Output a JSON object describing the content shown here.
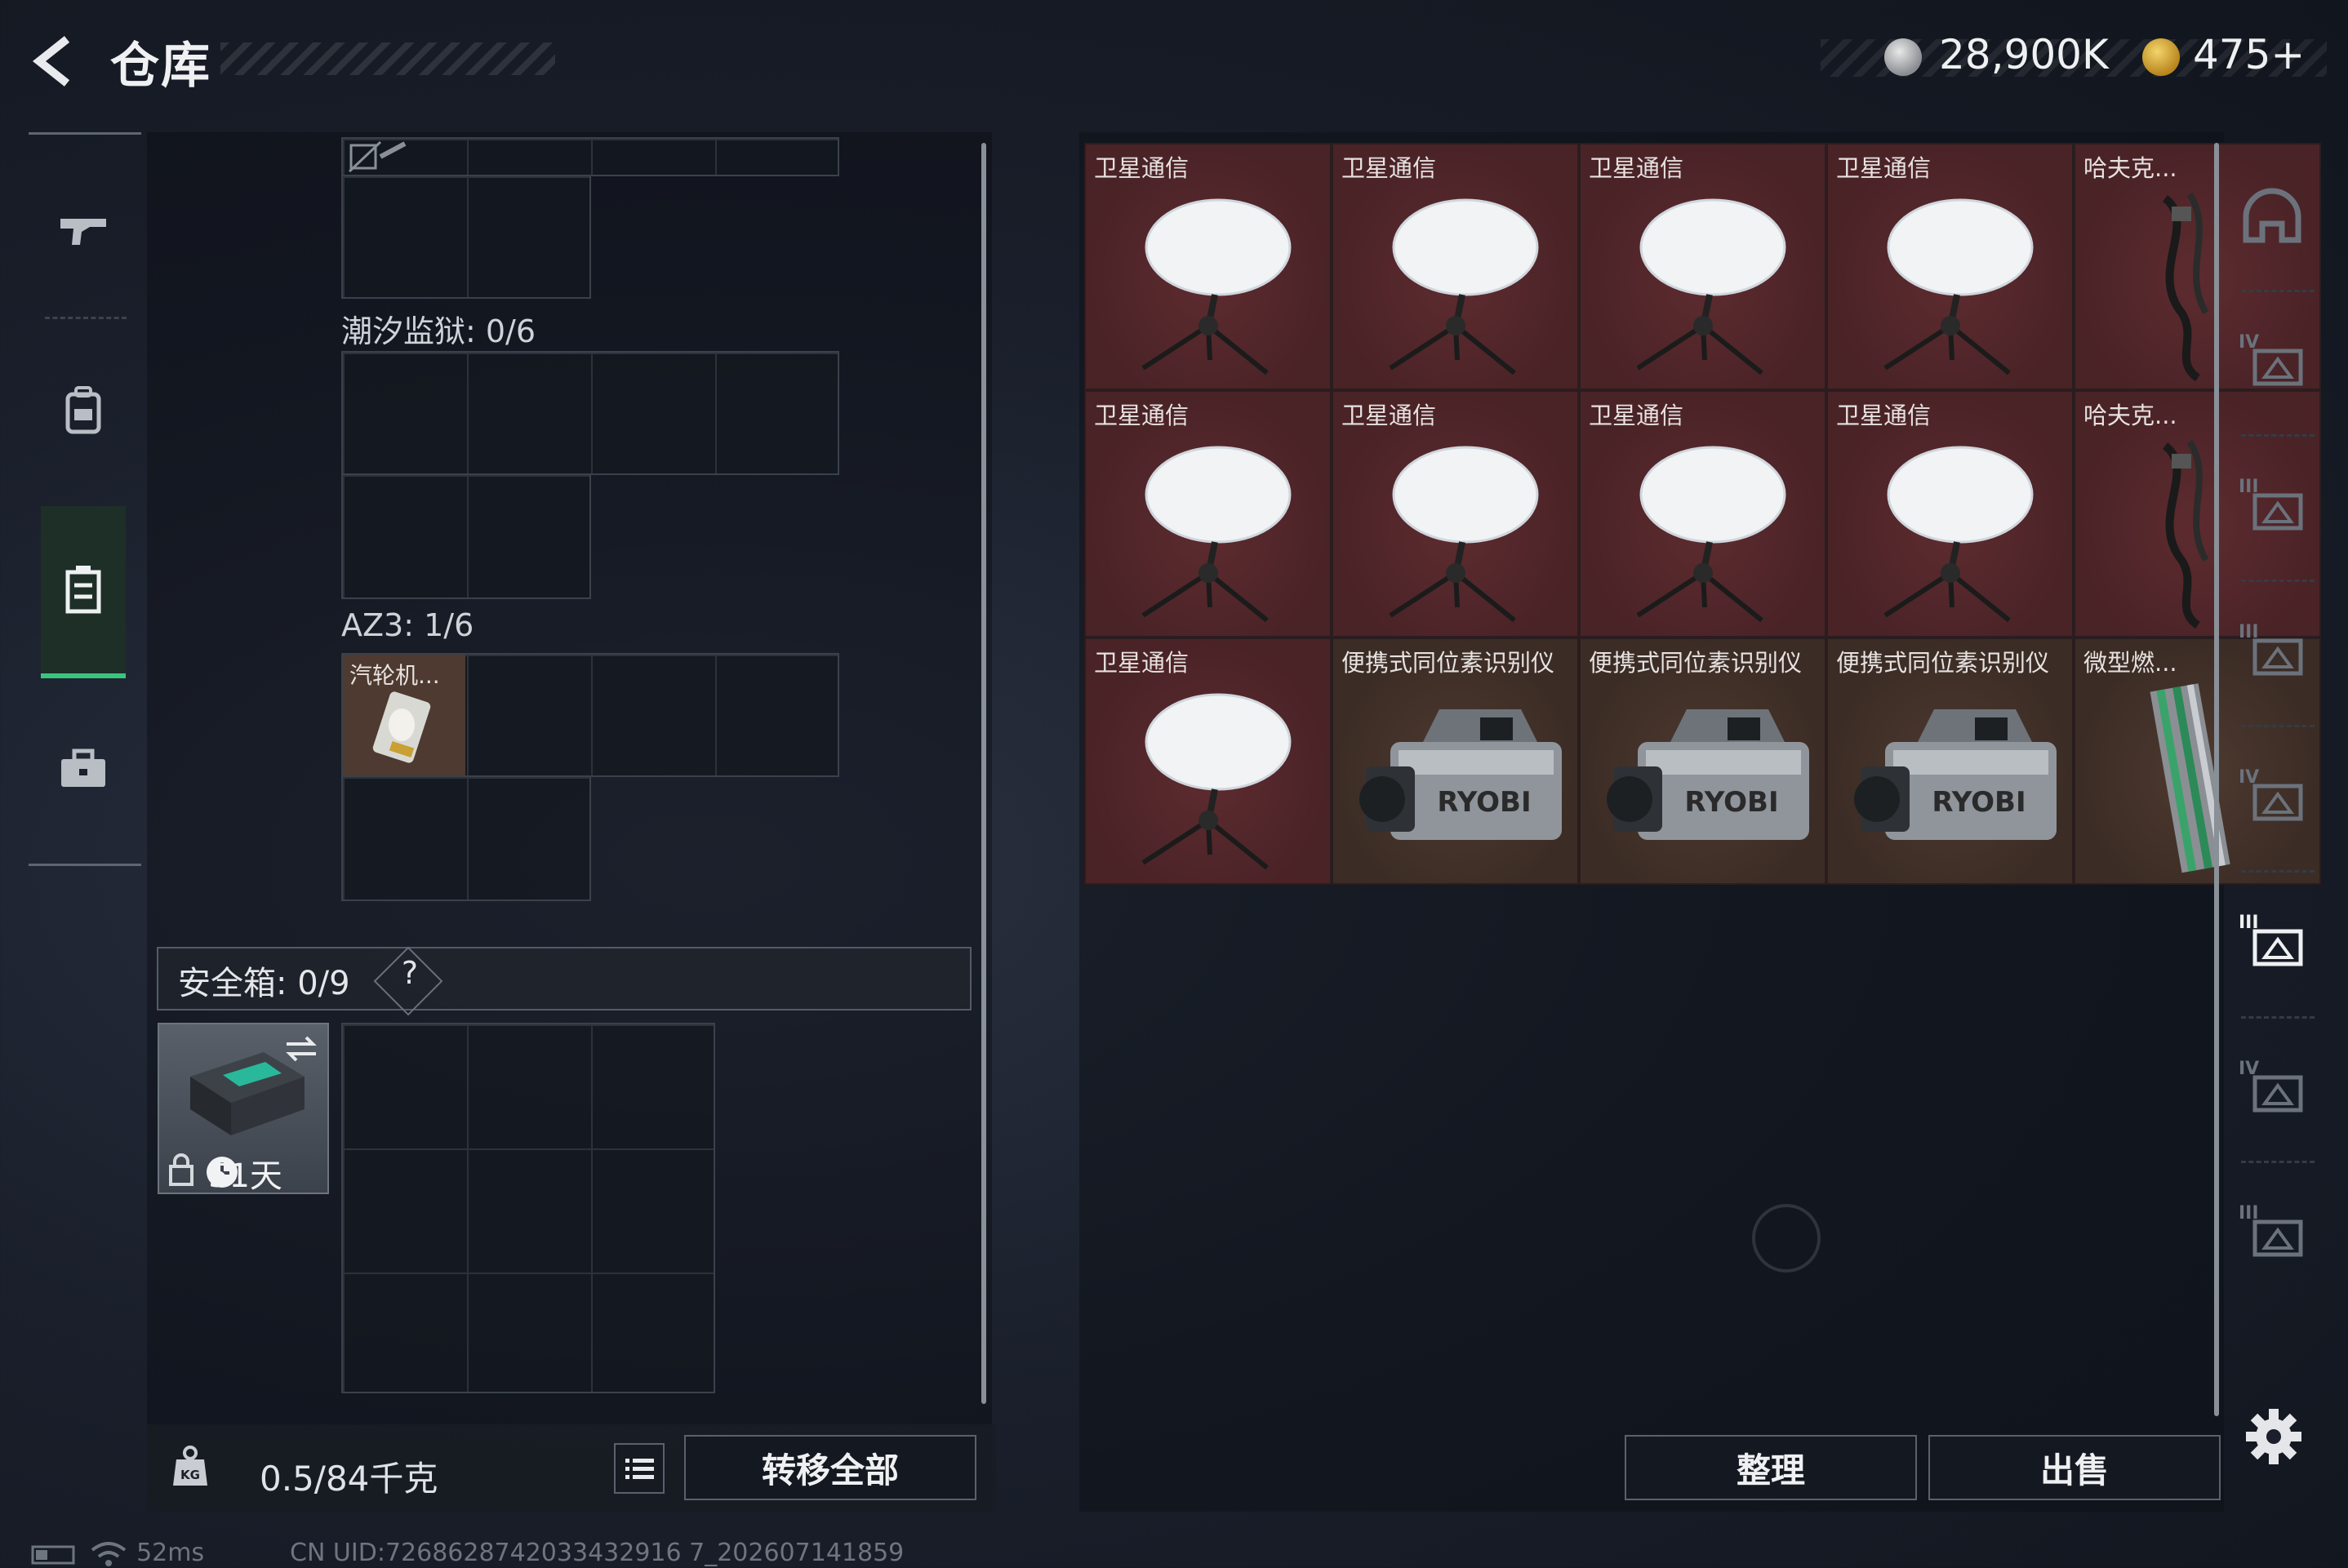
{
  "header": {
    "title": "仓库",
    "currency_1": "28,900K",
    "currency_2": "475+"
  },
  "left_rail": {
    "items": [
      "weapon-icon",
      "backpack-icon",
      "storage-icon",
      "case-icon"
    ],
    "active": "storage-icon"
  },
  "storage": {
    "sections": [
      {
        "label": "潮汐监狱: 0/6"
      },
      {
        "label": "AZ3: 1/6",
        "items": [
          {
            "name": "汽轮机..."
          }
        ]
      }
    ],
    "safe": {
      "label": "安全箱:  0/9",
      "help": "?",
      "timer": "51天"
    },
    "weight": "0.5/84千克",
    "transfer_all": "转移全部"
  },
  "inventory": {
    "items": [
      {
        "name": "卫星通信",
        "kind": "dish",
        "bg": "red"
      },
      {
        "name": "卫星通信",
        "kind": "dish",
        "bg": "red"
      },
      {
        "name": "卫星通信",
        "kind": "dish",
        "bg": "red"
      },
      {
        "name": "卫星通信",
        "kind": "dish",
        "bg": "red"
      },
      {
        "name": "哈夫克...",
        "kind": "strap",
        "bg": "red"
      },
      {
        "name": "卫星通信",
        "kind": "dish",
        "bg": "red"
      },
      {
        "name": "卫星通信",
        "kind": "dish",
        "bg": "red"
      },
      {
        "name": "卫星通信",
        "kind": "dish",
        "bg": "red"
      },
      {
        "name": "卫星通信",
        "kind": "dish",
        "bg": "red"
      },
      {
        "name": "哈夫克...",
        "kind": "strap",
        "bg": "red"
      },
      {
        "name": "卫星通信",
        "kind": "dish",
        "bg": "red"
      },
      {
        "name": "便携式同位素识别仪",
        "kind": "device",
        "bg": "brown"
      },
      {
        "name": "便携式同位素识别仪",
        "kind": "device",
        "bg": "brown"
      },
      {
        "name": "便携式同位素识别仪",
        "kind": "device",
        "bg": "brown"
      },
      {
        "name": "微型燃...",
        "kind": "rod",
        "bg": "brown"
      }
    ],
    "device_brand": "RYOBI",
    "sort": "整理",
    "sell": "出售"
  },
  "right_rail": {
    "levels": [
      "",
      "IV",
      "III",
      "III",
      "IV",
      "III",
      "IV",
      "III"
    ]
  },
  "status": {
    "ping": "52ms",
    "uid": "CN UID:7268628742033432916 7_202607141859"
  },
  "colors": {
    "accent_green": "#3ac57f",
    "item_red": "#4a2327",
    "item_brown": "#3b2c25"
  }
}
